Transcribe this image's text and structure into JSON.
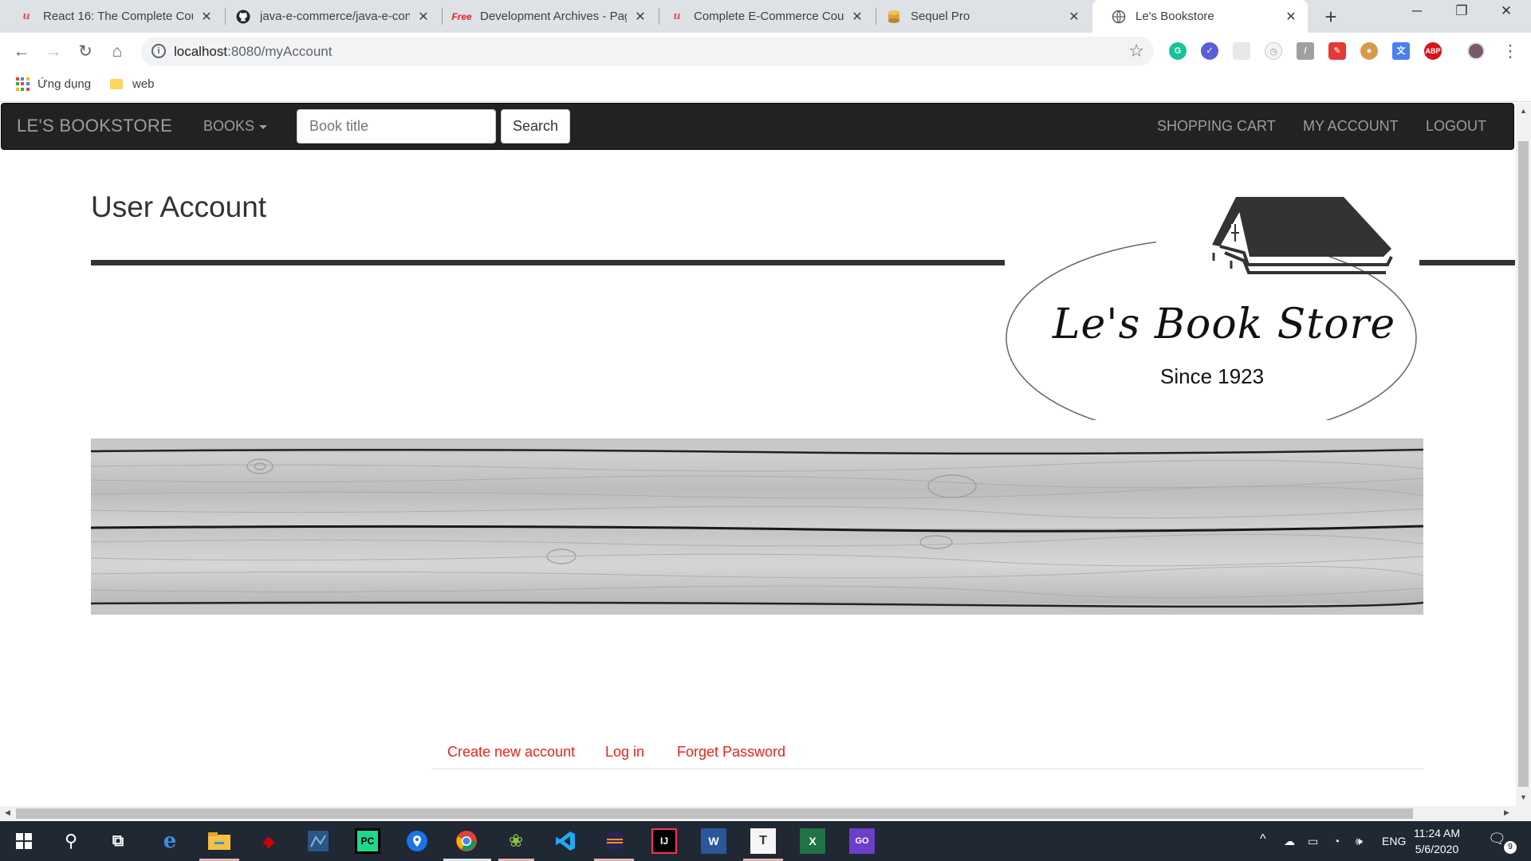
{
  "browser": {
    "tabs": [
      {
        "title": "React 16: The Complete Cour",
        "icon": "udemy-icon"
      },
      {
        "title": "java-e-commerce/java-e-con",
        "icon": "github-icon"
      },
      {
        "title": "Development Archives - Pag",
        "icon": "free-icon",
        "icon_text": "Free"
      },
      {
        "title": "Complete E-Commerce Cour",
        "icon": "udemy-icon"
      },
      {
        "title": "Sequel Pro",
        "icon": "database-icon"
      },
      {
        "title": "Le's Bookstore",
        "icon": "globe-icon"
      }
    ],
    "url_host": "localhost",
    "url_path": ":8080/myAccount",
    "bookmarks": [
      {
        "label": "Ứng dụng",
        "icon": "apps-icon"
      },
      {
        "label": "web",
        "icon": "folder-icon"
      }
    ],
    "extension_abp_text": "ABP"
  },
  "navbar": {
    "brand": "LE'S BOOKSTORE",
    "books_label": "BOOKS",
    "search_placeholder": "Book title",
    "search_button": "Search",
    "shopping_cart": "SHOPPING CART",
    "my_account": "MY ACCOUNT",
    "logout": "LOGOUT"
  },
  "page": {
    "title": "User Account",
    "logo_name": "Le's Book Store",
    "logo_since": "Since 1923",
    "tabs": [
      "Create new account",
      "Log in",
      "Forget Password"
    ]
  },
  "taskbar": {
    "language": "ENG",
    "time": "11:24 AM",
    "date": "5/6/2020",
    "notification_count": "9",
    "app_labels": {
      "pycharm": "PC",
      "intellij": "IJ",
      "word": "W",
      "typora": "T",
      "excel": "X",
      "goland": "GO"
    }
  },
  "colors": {
    "navbar_bg": "#222222",
    "navbar_text": "#9d9d9d",
    "link_red": "#e8231b",
    "tabstrip_bg": "#dee1e6",
    "taskbar_bg": "#1f2833"
  }
}
